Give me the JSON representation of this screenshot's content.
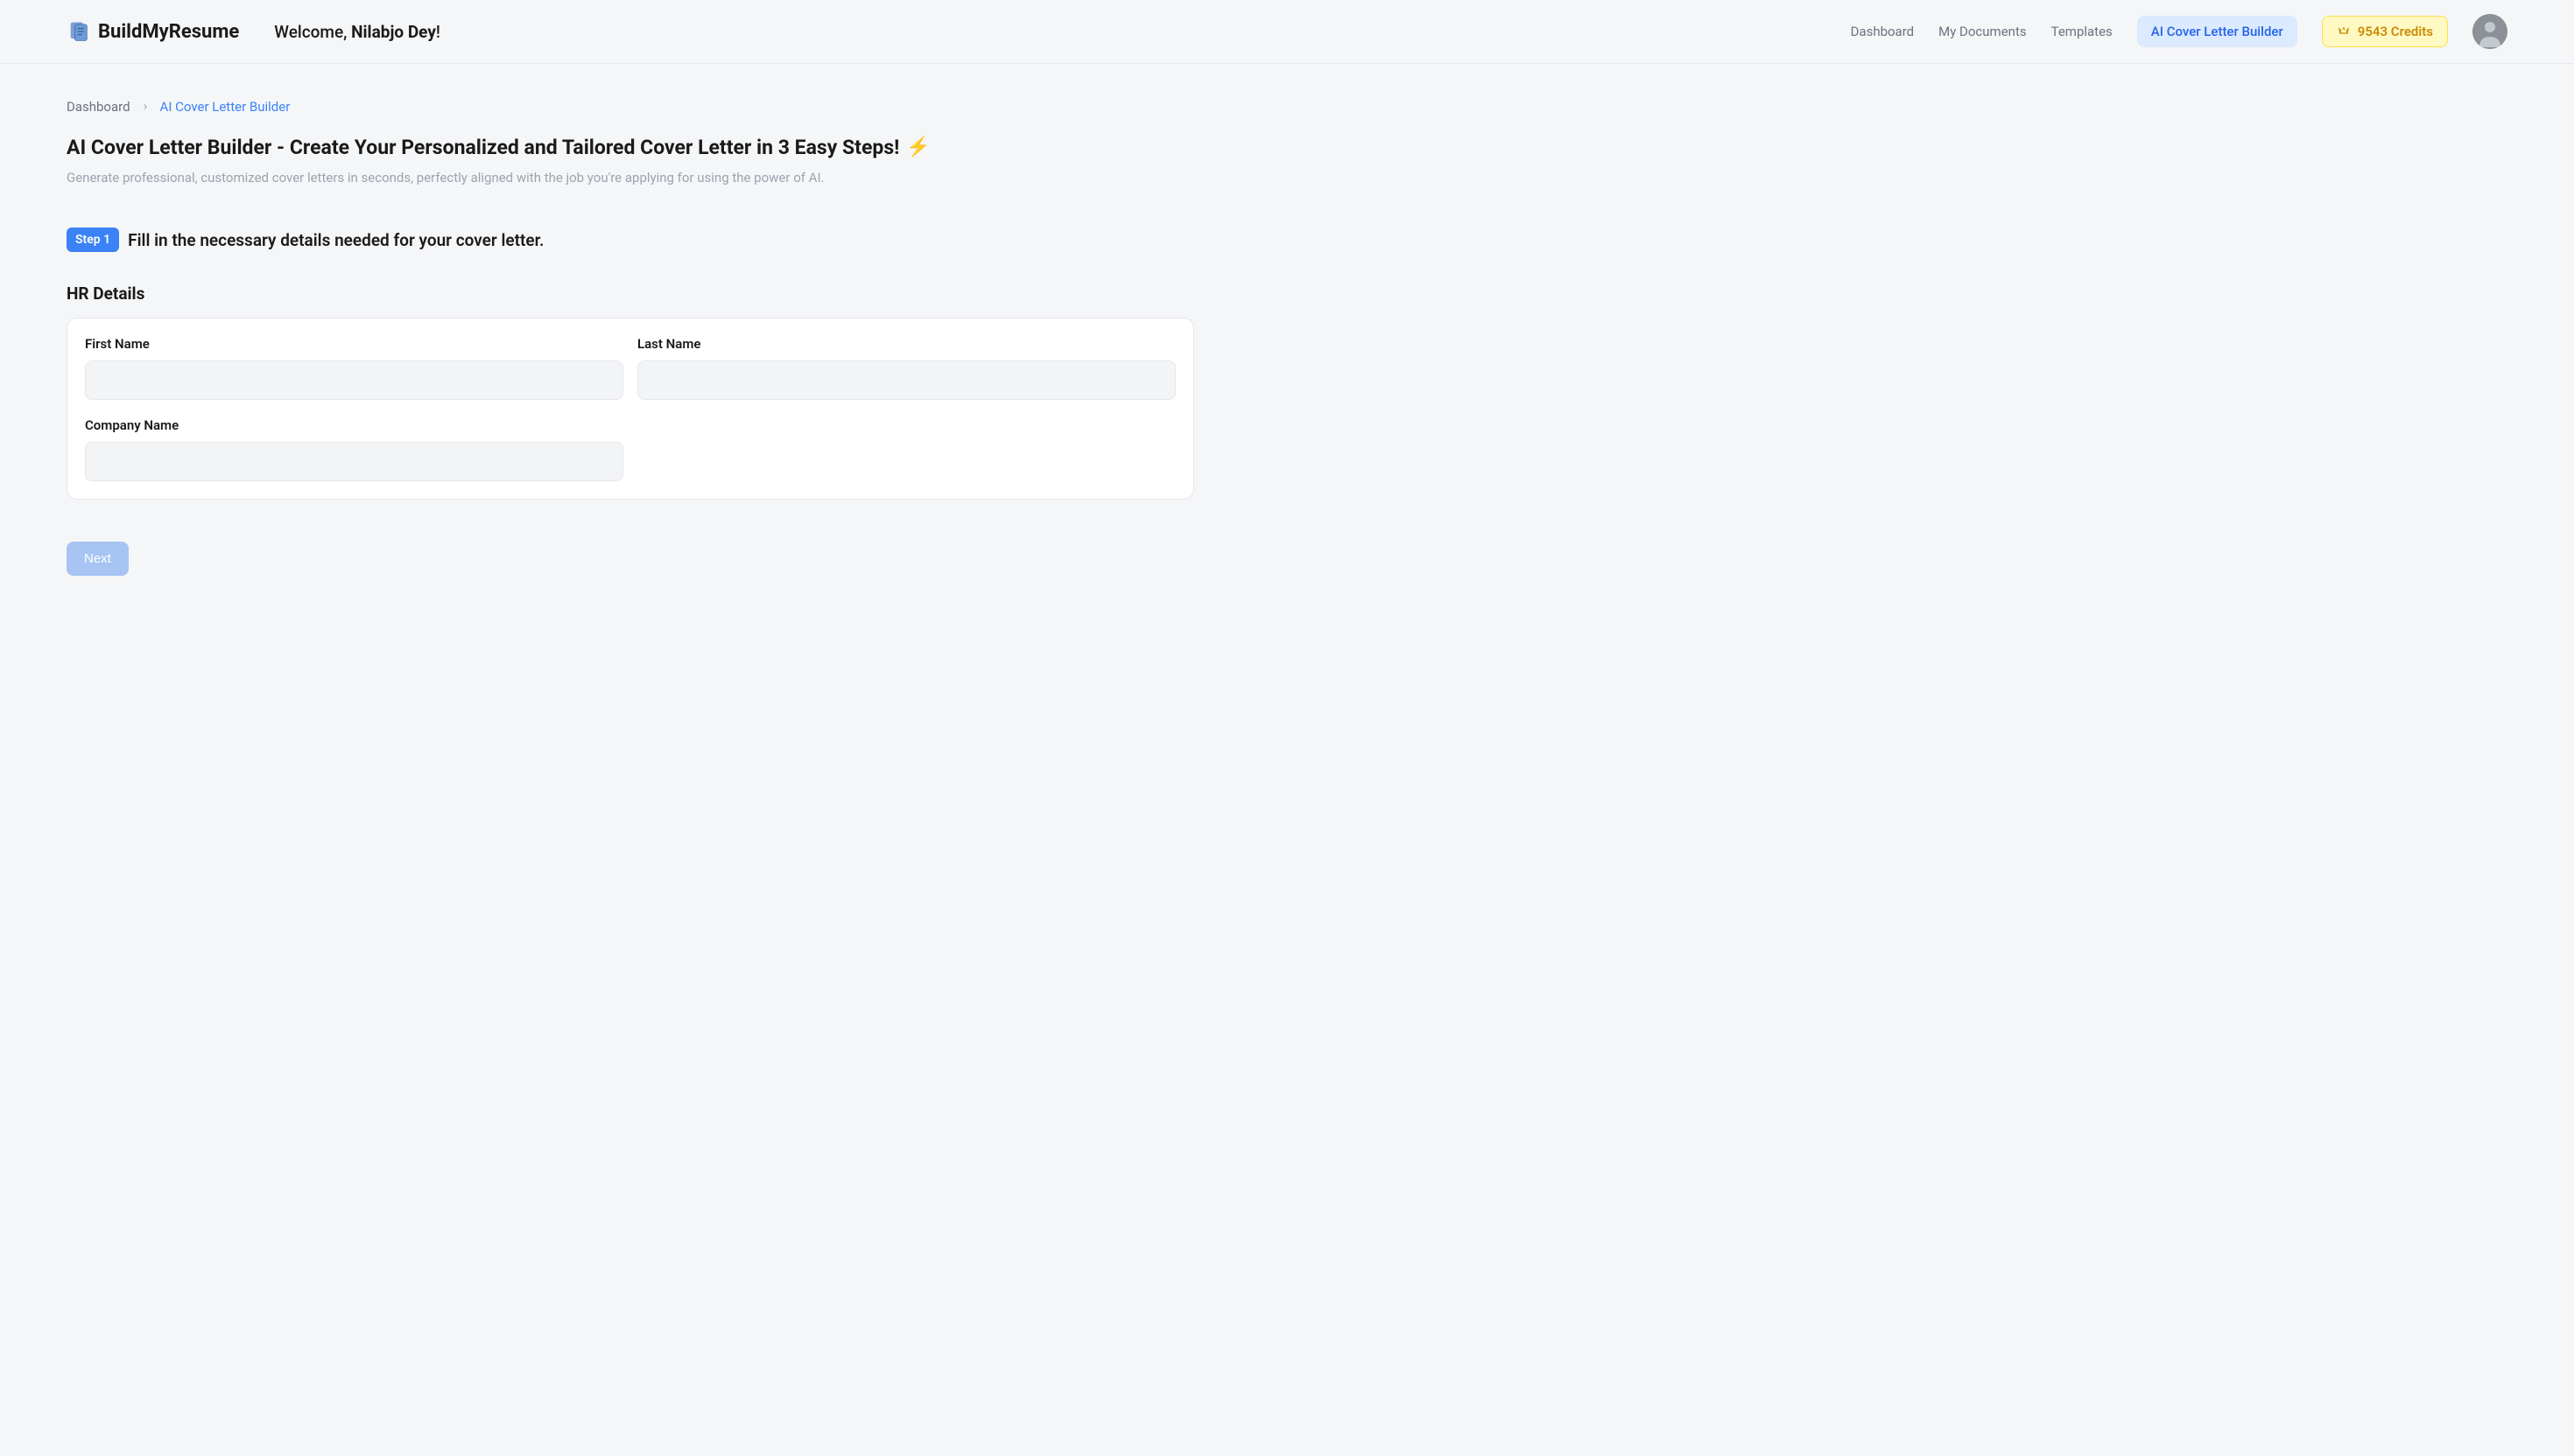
{
  "header": {
    "logo_text": "BuildMyResume",
    "welcome_prefix": "Welcome, ",
    "welcome_name": "Nilabjo Dey",
    "welcome_suffix": "!",
    "nav": {
      "dashboard": "Dashboard",
      "my_documents": "My Documents",
      "templates": "Templates",
      "ai_cover_letter": "AI Cover Letter Builder"
    },
    "credits_count": "9543 Credits"
  },
  "breadcrumb": {
    "dashboard": "Dashboard",
    "current": "AI Cover Letter Builder"
  },
  "page": {
    "title": "AI Cover Letter Builder - Create Your Personalized and Tailored Cover Letter in 3 Easy Steps!",
    "subtitle": "Generate professional, customized cover letters in seconds, perfectly aligned with the job you're applying for using the power of AI."
  },
  "step": {
    "badge": "Step 1",
    "text": "Fill in the necessary details needed for your cover letter."
  },
  "form": {
    "section_title": "HR Details",
    "first_name_label": "First Name",
    "first_name_value": "",
    "last_name_label": "Last Name",
    "last_name_value": "",
    "company_name_label": "Company Name",
    "company_name_value": ""
  },
  "buttons": {
    "next": "Next"
  }
}
